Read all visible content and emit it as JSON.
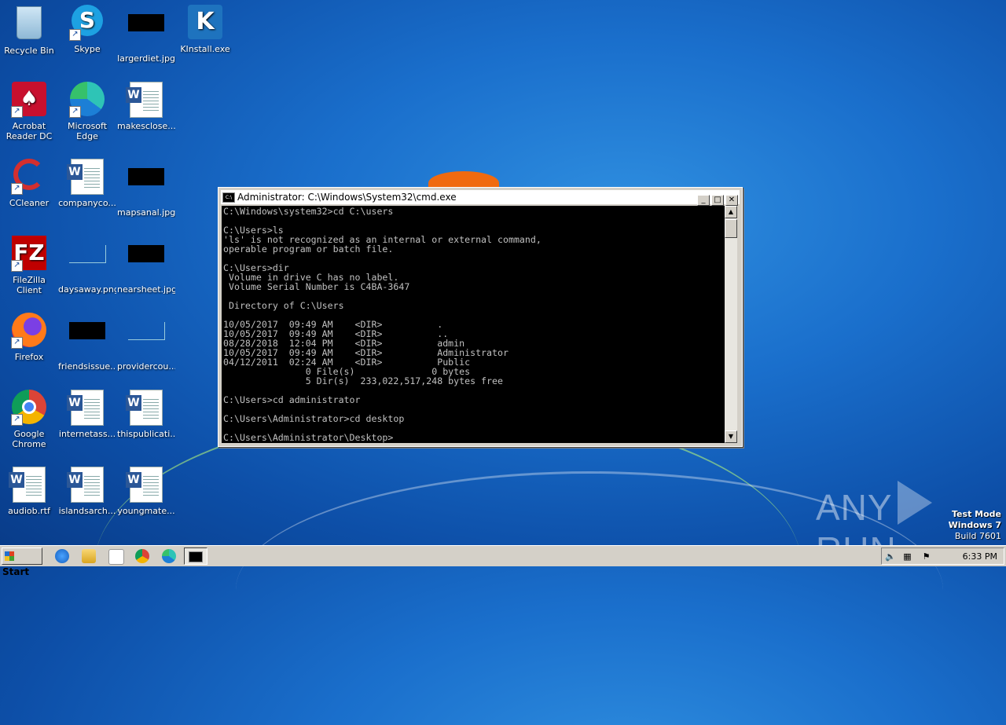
{
  "desktop": {
    "icons": [
      {
        "label": "Recycle Bin"
      },
      {
        "label": "Skype"
      },
      {
        "label": "largerdiet.jpg"
      },
      {
        "label": "KInstall.exe"
      },
      {
        "label": "Acrobat Reader DC"
      },
      {
        "label": "Microsoft Edge"
      },
      {
        "label": "makesclose...."
      },
      {
        "label": "CCleaner"
      },
      {
        "label": "companyco..."
      },
      {
        "label": "mapsanal.jpg"
      },
      {
        "label": "FileZilla Client"
      },
      {
        "label": "daysaway.png"
      },
      {
        "label": "nearsheet.jpg"
      },
      {
        "label": "Firefox"
      },
      {
        "label": "friendsissue..."
      },
      {
        "label": "providercou..."
      },
      {
        "label": "Google Chrome"
      },
      {
        "label": "internetass..."
      },
      {
        "label": "thispublicati..."
      },
      {
        "label": "audiob.rtf"
      },
      {
        "label": "islandsarch..."
      },
      {
        "label": "youngmate..."
      }
    ]
  },
  "cmd_window": {
    "title": "Administrator: C:\\Windows\\System32\\cmd.exe",
    "console_text": "C:\\Windows\\system32>cd C:\\users\n\nC:\\Users>ls\n'ls' is not recognized as an internal or external command,\noperable program or batch file.\n\nC:\\Users>dir\n Volume in drive C has no label.\n Volume Serial Number is C4BA-3647\n\n Directory of C:\\Users\n\n10/05/2017  09:49 AM    <DIR>          .\n10/05/2017  09:49 AM    <DIR>          ..\n08/28/2018  12:04 PM    <DIR>          admin\n10/05/2017  09:49 AM    <DIR>          Administrator\n04/12/2011  02:24 AM    <DIR>          Public\n               0 File(s)              0 bytes\n               5 Dir(s)  233,022,517,248 bytes free\n\nC:\\Users>cd administrator\n\nC:\\Users\\Administrator>cd desktop\n\nC:\\Users\\Administrator\\Desktop>"
  },
  "taskbar": {
    "start_label": "Start",
    "clock": "6:33 PM"
  },
  "watermark": {
    "line1": "Test Mode",
    "line2": "Windows 7",
    "line3": "Build 7601",
    "brand": "ANY",
    "brand2": "RUN"
  }
}
